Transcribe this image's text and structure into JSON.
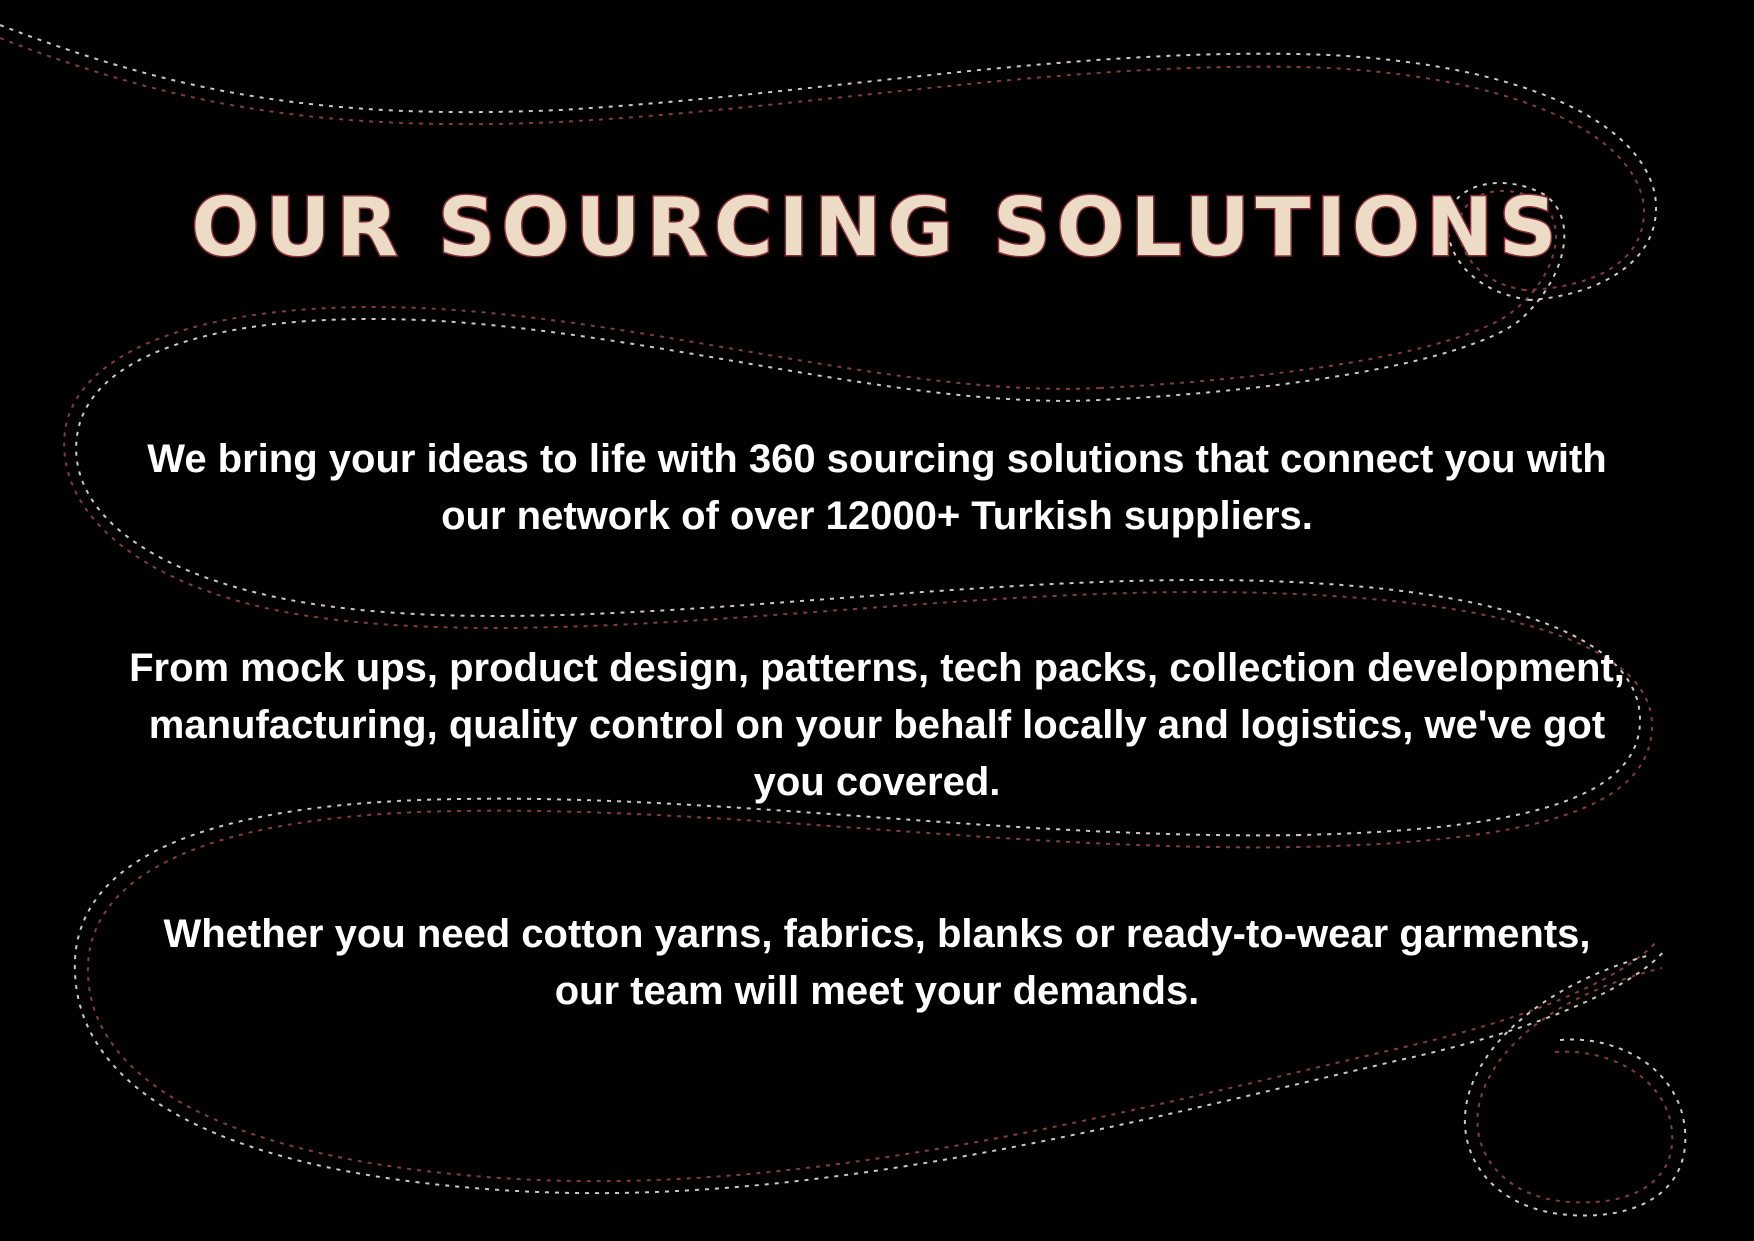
{
  "title": "OUR SOURCING SOLUTIONS",
  "paragraphs": [
    "We bring your ideas to life with 360 sourcing solutions that connect you with our network of over 12000+ Turkish suppliers.",
    "From mock ups, product design, patterns, tech packs, collection development, manufacturing, quality control on your behalf locally and logistics, we've got you covered.",
    "Whether you need cotton yarns, fabrics, blanks or ready-to-wear garments, our team will meet your demands."
  ],
  "colors": {
    "background": "#000000",
    "title_fill": "#eddcc5",
    "title_outline": "#8a2d3a",
    "body_text": "#ffffff",
    "stitch_white": "#f2ece4",
    "stitch_red": "#8a3f4a"
  }
}
